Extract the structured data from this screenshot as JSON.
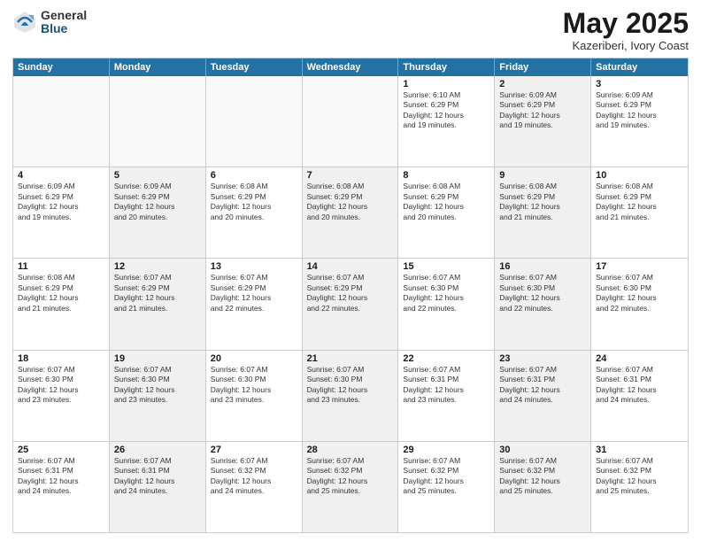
{
  "logo": {
    "general": "General",
    "blue": "Blue"
  },
  "header": {
    "month": "May 2025",
    "location": "Kazeriberi, Ivory Coast"
  },
  "weekdays": [
    "Sunday",
    "Monday",
    "Tuesday",
    "Wednesday",
    "Thursday",
    "Friday",
    "Saturday"
  ],
  "rows": [
    [
      {
        "day": "",
        "info": "",
        "empty": true
      },
      {
        "day": "",
        "info": "",
        "empty": true
      },
      {
        "day": "",
        "info": "",
        "empty": true
      },
      {
        "day": "",
        "info": "",
        "empty": true
      },
      {
        "day": "1",
        "info": "Sunrise: 6:10 AM\nSunset: 6:29 PM\nDaylight: 12 hours\nand 19 minutes."
      },
      {
        "day": "2",
        "info": "Sunrise: 6:09 AM\nSunset: 6:29 PM\nDaylight: 12 hours\nand 19 minutes.",
        "shaded": true
      },
      {
        "day": "3",
        "info": "Sunrise: 6:09 AM\nSunset: 6:29 PM\nDaylight: 12 hours\nand 19 minutes."
      }
    ],
    [
      {
        "day": "4",
        "info": "Sunrise: 6:09 AM\nSunset: 6:29 PM\nDaylight: 12 hours\nand 19 minutes."
      },
      {
        "day": "5",
        "info": "Sunrise: 6:09 AM\nSunset: 6:29 PM\nDaylight: 12 hours\nand 20 minutes.",
        "shaded": true
      },
      {
        "day": "6",
        "info": "Sunrise: 6:08 AM\nSunset: 6:29 PM\nDaylight: 12 hours\nand 20 minutes."
      },
      {
        "day": "7",
        "info": "Sunrise: 6:08 AM\nSunset: 6:29 PM\nDaylight: 12 hours\nand 20 minutes.",
        "shaded": true
      },
      {
        "day": "8",
        "info": "Sunrise: 6:08 AM\nSunset: 6:29 PM\nDaylight: 12 hours\nand 20 minutes."
      },
      {
        "day": "9",
        "info": "Sunrise: 6:08 AM\nSunset: 6:29 PM\nDaylight: 12 hours\nand 21 minutes.",
        "shaded": true
      },
      {
        "day": "10",
        "info": "Sunrise: 6:08 AM\nSunset: 6:29 PM\nDaylight: 12 hours\nand 21 minutes."
      }
    ],
    [
      {
        "day": "11",
        "info": "Sunrise: 6:08 AM\nSunset: 6:29 PM\nDaylight: 12 hours\nand 21 minutes."
      },
      {
        "day": "12",
        "info": "Sunrise: 6:07 AM\nSunset: 6:29 PM\nDaylight: 12 hours\nand 21 minutes.",
        "shaded": true
      },
      {
        "day": "13",
        "info": "Sunrise: 6:07 AM\nSunset: 6:29 PM\nDaylight: 12 hours\nand 22 minutes."
      },
      {
        "day": "14",
        "info": "Sunrise: 6:07 AM\nSunset: 6:29 PM\nDaylight: 12 hours\nand 22 minutes.",
        "shaded": true
      },
      {
        "day": "15",
        "info": "Sunrise: 6:07 AM\nSunset: 6:30 PM\nDaylight: 12 hours\nand 22 minutes."
      },
      {
        "day": "16",
        "info": "Sunrise: 6:07 AM\nSunset: 6:30 PM\nDaylight: 12 hours\nand 22 minutes.",
        "shaded": true
      },
      {
        "day": "17",
        "info": "Sunrise: 6:07 AM\nSunset: 6:30 PM\nDaylight: 12 hours\nand 22 minutes."
      }
    ],
    [
      {
        "day": "18",
        "info": "Sunrise: 6:07 AM\nSunset: 6:30 PM\nDaylight: 12 hours\nand 23 minutes."
      },
      {
        "day": "19",
        "info": "Sunrise: 6:07 AM\nSunset: 6:30 PM\nDaylight: 12 hours\nand 23 minutes.",
        "shaded": true
      },
      {
        "day": "20",
        "info": "Sunrise: 6:07 AM\nSunset: 6:30 PM\nDaylight: 12 hours\nand 23 minutes."
      },
      {
        "day": "21",
        "info": "Sunrise: 6:07 AM\nSunset: 6:30 PM\nDaylight: 12 hours\nand 23 minutes.",
        "shaded": true
      },
      {
        "day": "22",
        "info": "Sunrise: 6:07 AM\nSunset: 6:31 PM\nDaylight: 12 hours\nand 23 minutes."
      },
      {
        "day": "23",
        "info": "Sunrise: 6:07 AM\nSunset: 6:31 PM\nDaylight: 12 hours\nand 24 minutes.",
        "shaded": true
      },
      {
        "day": "24",
        "info": "Sunrise: 6:07 AM\nSunset: 6:31 PM\nDaylight: 12 hours\nand 24 minutes."
      }
    ],
    [
      {
        "day": "25",
        "info": "Sunrise: 6:07 AM\nSunset: 6:31 PM\nDaylight: 12 hours\nand 24 minutes."
      },
      {
        "day": "26",
        "info": "Sunrise: 6:07 AM\nSunset: 6:31 PM\nDaylight: 12 hours\nand 24 minutes.",
        "shaded": true
      },
      {
        "day": "27",
        "info": "Sunrise: 6:07 AM\nSunset: 6:32 PM\nDaylight: 12 hours\nand 24 minutes."
      },
      {
        "day": "28",
        "info": "Sunrise: 6:07 AM\nSunset: 6:32 PM\nDaylight: 12 hours\nand 25 minutes.",
        "shaded": true
      },
      {
        "day": "29",
        "info": "Sunrise: 6:07 AM\nSunset: 6:32 PM\nDaylight: 12 hours\nand 25 minutes."
      },
      {
        "day": "30",
        "info": "Sunrise: 6:07 AM\nSunset: 6:32 PM\nDaylight: 12 hours\nand 25 minutes.",
        "shaded": true
      },
      {
        "day": "31",
        "info": "Sunrise: 6:07 AM\nSunset: 6:32 PM\nDaylight: 12 hours\nand 25 minutes."
      }
    ]
  ]
}
